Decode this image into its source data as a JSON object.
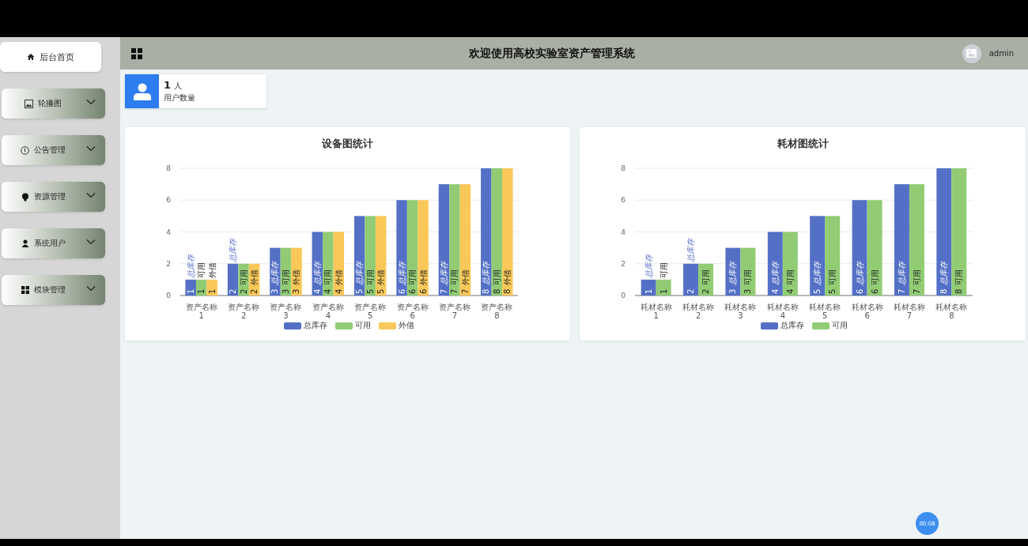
{
  "header": {
    "title": "欢迎使用高校实验室资产管理系统",
    "user": "admin"
  },
  "sidebar": {
    "items": [
      {
        "label": "后台首页",
        "kind": "link",
        "selected": true
      },
      {
        "label": "轮播图",
        "kind": "menu",
        "selected": false,
        "expanded": false
      },
      {
        "label": "公告管理",
        "kind": "menu",
        "selected": false,
        "expanded": false
      },
      {
        "label": "资源管理",
        "kind": "menu",
        "selected": false,
        "expanded": false
      },
      {
        "label": "系统用户",
        "kind": "menu",
        "selected": false,
        "expanded": false
      },
      {
        "label": "模块管理",
        "kind": "menu",
        "selected": false,
        "expanded": false
      }
    ]
  },
  "stat_card": {
    "value": "1",
    "unit": "人",
    "label": "用户数量"
  },
  "charts": [
    {
      "chart_data": {
        "type": "bar",
        "title": "设备图统计",
        "categories": [
          "资产名称1",
          "资产名称2",
          "资产名称3",
          "资产名称4",
          "资产名称5",
          "资产名称6",
          "资产名称7",
          "资产名称8"
        ],
        "series": [
          {
            "name": "总库存",
            "color": "#5470c6",
            "values": [
              1,
              2,
              3,
              4,
              5,
              6,
              7,
              8
            ]
          },
          {
            "name": "可用",
            "color": "#91cc75",
            "values": [
              1,
              2,
              3,
              4,
              5,
              6,
              7,
              8
            ]
          },
          {
            "name": "外借",
            "color": "#fac858",
            "values": [
              1,
              2,
              3,
              4,
              5,
              6,
              7,
              8
            ]
          }
        ],
        "ylim": [
          0,
          8
        ],
        "yticks": [
          0,
          2,
          4,
          6,
          8
        ],
        "data_labels": true,
        "grid": true,
        "legend": true
      }
    },
    {
      "chart_data": {
        "type": "bar",
        "title": "耗材图统计",
        "categories": [
          "耗材名称1",
          "耗材名称2",
          "耗材名称3",
          "耗材名称4",
          "耗材名称5",
          "耗材名称6",
          "耗材名称7",
          "耗材名称8"
        ],
        "series": [
          {
            "name": "总库存",
            "color": "#5470c6",
            "values": [
              1,
              2,
              3,
              4,
              5,
              6,
              7,
              8
            ]
          },
          {
            "name": "可用",
            "color": "#91cc75",
            "values": [
              1,
              2,
              3,
              4,
              5,
              6,
              7,
              8
            ]
          }
        ],
        "ylim": [
          0,
          8
        ],
        "yticks": [
          0,
          2,
          4,
          6,
          8
        ],
        "data_labels": true,
        "grid": true,
        "legend": true
      }
    }
  ],
  "timer": "00:08"
}
